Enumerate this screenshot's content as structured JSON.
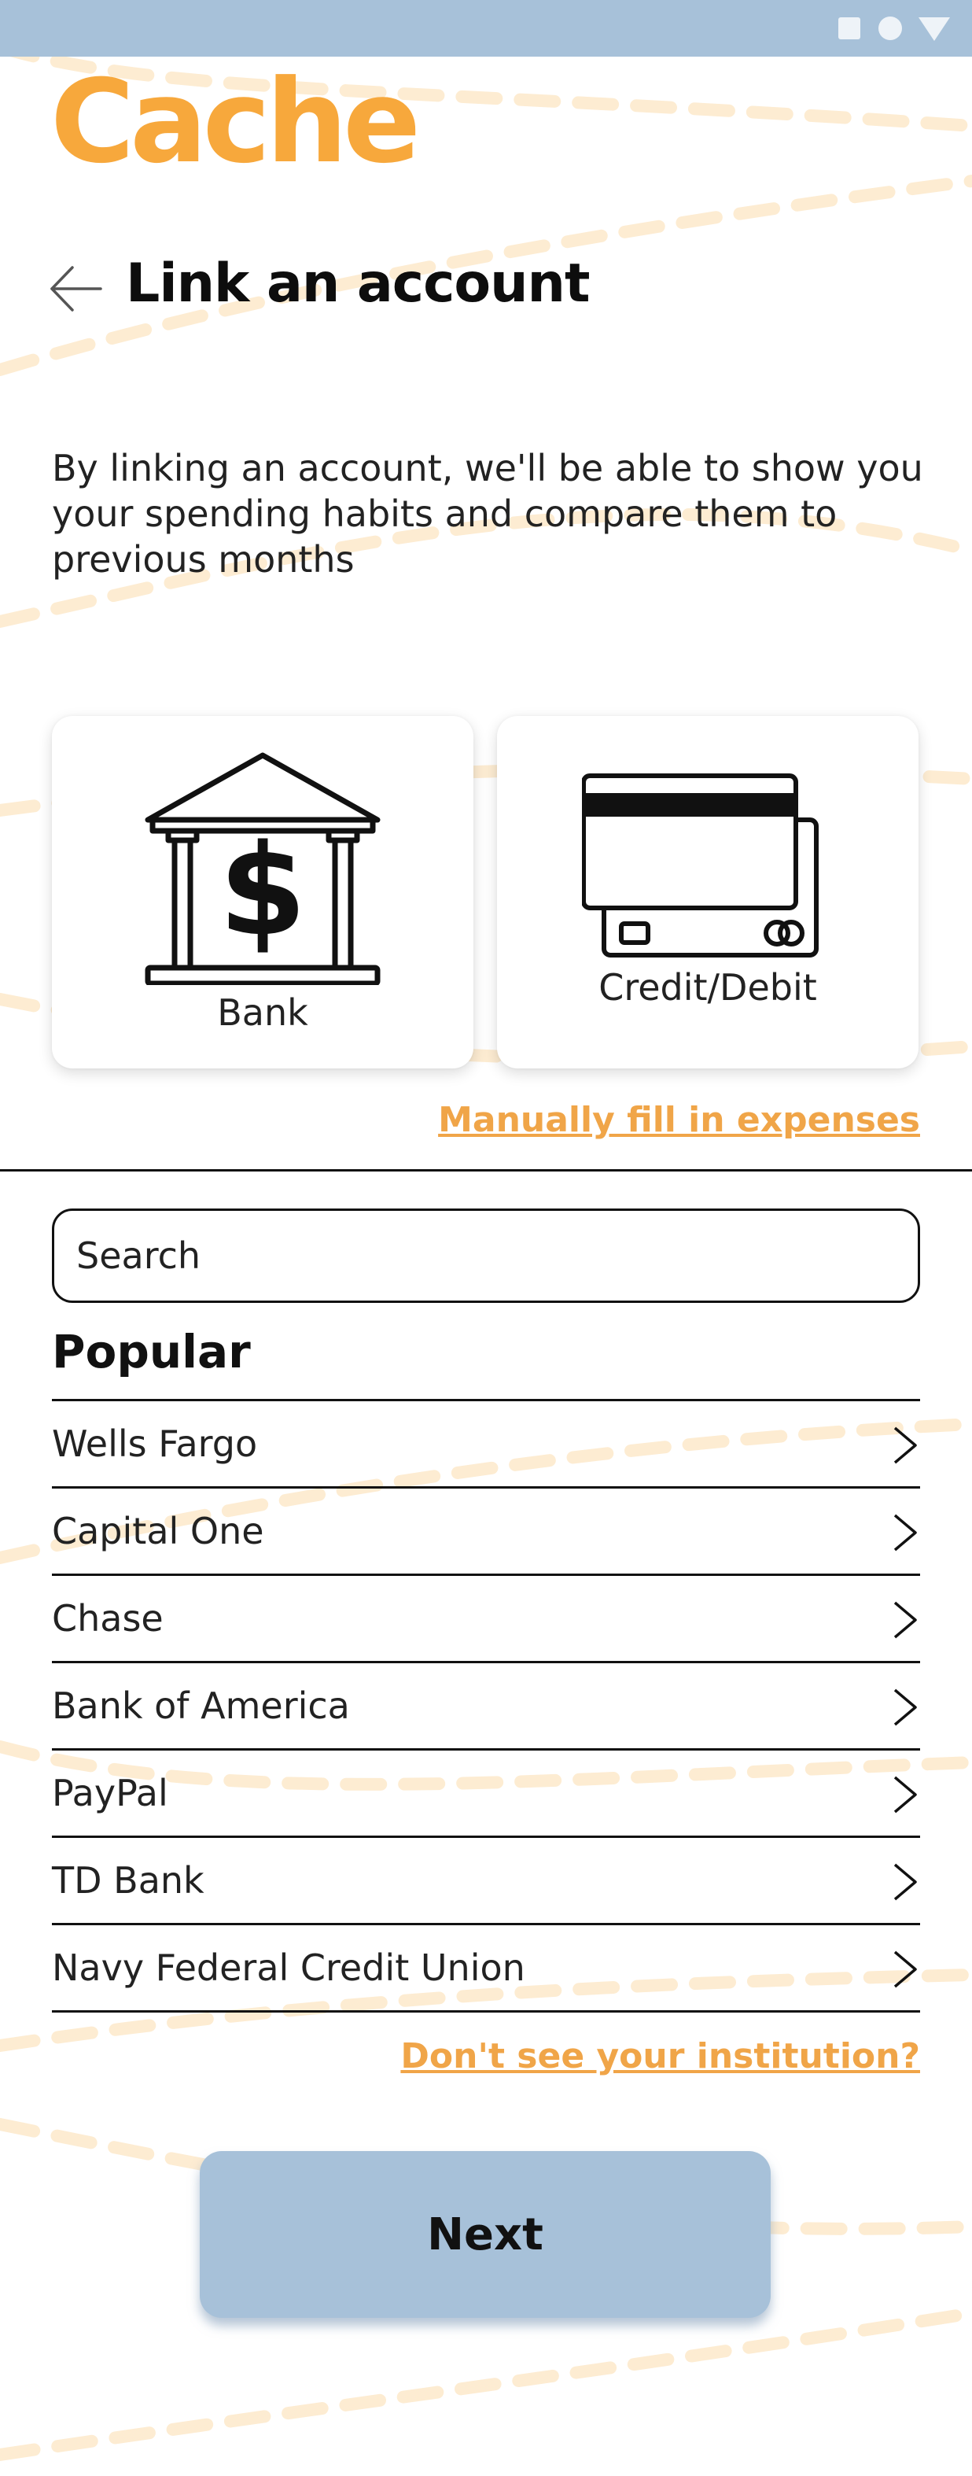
{
  "app": {
    "logo": "Cache",
    "brand_color": "#f7a83c",
    "accent_color": "#a7c1d9",
    "link_color": "#f0a548"
  },
  "status_bar": {
    "icons": [
      "square-icon",
      "circle-icon",
      "triangle-icon"
    ]
  },
  "header": {
    "back_icon": "arrow-left-icon",
    "title": "Link an account"
  },
  "intro": {
    "text": "By linking an account, we'll be  able to show you your spending habits and compare them to previous months"
  },
  "account_types": [
    {
      "label": "Bank",
      "icon": "bank-building-dollar-icon"
    },
    {
      "label": "Credit/Debit",
      "icon": "credit-cards-icon"
    }
  ],
  "manual_link": "Manually fill in expenses",
  "search": {
    "placeholder": "Search",
    "value": ""
  },
  "popular": {
    "title": "Popular",
    "items": [
      {
        "label": "Wells Fargo"
      },
      {
        "label": "Capital One"
      },
      {
        "label": "Chase"
      },
      {
        "label": "Bank of America"
      },
      {
        "label": "PayPal"
      },
      {
        "label": "TD Bank"
      },
      {
        "label": "Navy Federal Credit Union"
      }
    ],
    "chevron_icon": "chevron-right-icon"
  },
  "institution_link": "Don't see your institution?",
  "next_button": "Next"
}
